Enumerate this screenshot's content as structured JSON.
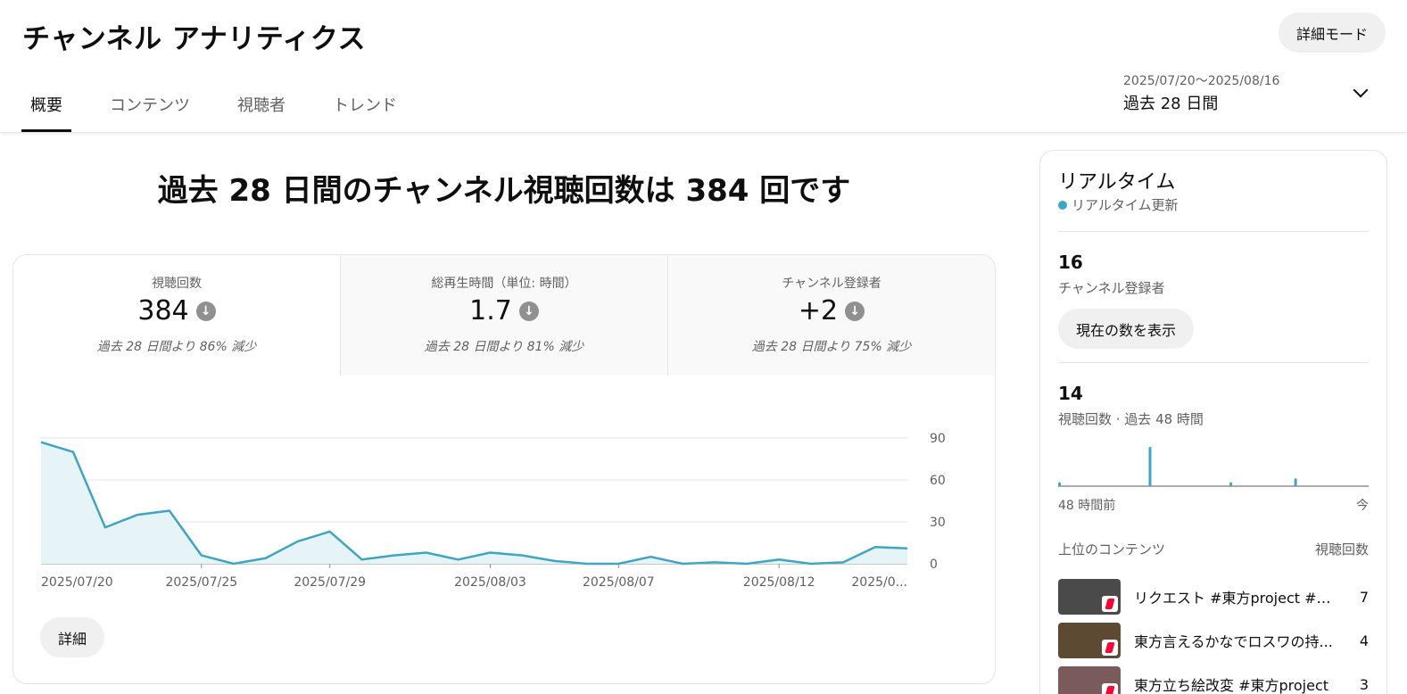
{
  "header": {
    "title": "チャンネル アナリティクス",
    "advanced_mode": "詳細モード"
  },
  "tabs": [
    {
      "label": "概要",
      "active": true
    },
    {
      "label": "コンテンツ",
      "active": false
    },
    {
      "label": "視聴者",
      "active": false
    },
    {
      "label": "トレンド",
      "active": false
    }
  ],
  "date_picker": {
    "range": "2025/07/20〜2025/08/16",
    "label": "過去 28 日間"
  },
  "headline": "過去 28 日間のチャンネル視聴回数は 384 回です",
  "metrics": [
    {
      "label": "視聴回数",
      "value": "384",
      "change": "過去 28 日間より 86% 減少",
      "trend": "down"
    },
    {
      "label": "総再生時間（単位: 時間）",
      "value": "1.7",
      "change": "過去 28 日間より 81% 減少",
      "trend": "down"
    },
    {
      "label": "チャンネル登録者",
      "value": "+2",
      "change": "過去 28 日間より 75% 減少",
      "trend": "down"
    }
  ],
  "details_button": "詳細",
  "chart_data": {
    "type": "area",
    "x": [
      "2025/07/20",
      "2025/07/21",
      "2025/07/22",
      "2025/07/23",
      "2025/07/24",
      "2025/07/25",
      "2025/07/26",
      "2025/07/27",
      "2025/07/28",
      "2025/07/29",
      "2025/07/30",
      "2025/07/31",
      "2025/08/01",
      "2025/08/02",
      "2025/08/03",
      "2025/08/04",
      "2025/08/05",
      "2025/08/06",
      "2025/08/07",
      "2025/08/08",
      "2025/08/09",
      "2025/08/10",
      "2025/08/11",
      "2025/08/12",
      "2025/08/13",
      "2025/08/14",
      "2025/08/15",
      "2025/08/16"
    ],
    "values": [
      87,
      80,
      26,
      35,
      38,
      6,
      0,
      4,
      16,
      23,
      3,
      6,
      8,
      3,
      8,
      6,
      2,
      0,
      0,
      5,
      0,
      1,
      0,
      3,
      0,
      1,
      12,
      11
    ],
    "tick_labels": [
      "2025/07/20",
      "2025/07/25",
      "2025/07/29",
      "2025/08/03",
      "2025/08/07",
      "2025/08/12",
      "2025/0..."
    ],
    "tick_indices": [
      0,
      5,
      9,
      14,
      18,
      23,
      27
    ],
    "y_ticks": [
      0,
      30,
      60,
      90
    ],
    "ylim": [
      0,
      90
    ],
    "grid": true,
    "line_color": "#3ea6c5",
    "fill_color": "#e6f4f8"
  },
  "realtime": {
    "title": "リアルタイム",
    "live_label": "リアルタイム更新",
    "subscribers_count": "16",
    "subscribers_label": "チャンネル登録者",
    "show_current_button": "現在の数を表示",
    "views_count": "14",
    "views_label": "視聴回数 · 過去 48 時間",
    "axis_left": "48 時間前",
    "axis_right": "今",
    "bars": [
      1,
      0,
      0,
      0,
      0,
      0,
      0,
      0,
      0,
      0,
      0,
      0,
      0,
      0,
      0,
      0,
      0,
      0,
      0,
      0,
      0,
      0,
      0,
      0,
      0,
      0,
      0,
      0,
      10,
      0,
      0,
      0,
      0,
      0,
      0,
      0,
      0,
      0,
      0,
      0,
      0,
      0,
      0,
      0,
      0,
      0,
      0,
      0,
      0,
      0,
      0,
      0,
      0,
      1,
      0,
      0,
      0,
      0,
      0,
      0,
      0,
      0,
      0,
      0,
      0,
      0,
      0,
      0,
      0,
      0,
      0,
      0,
      0,
      2,
      0,
      0,
      0,
      0,
      0,
      0,
      0,
      0,
      0,
      0,
      0,
      0,
      0,
      0,
      0,
      0,
      0,
      0,
      0,
      0,
      0,
      0
    ],
    "top_content_header": "上位のコンテンツ",
    "top_content_views_header": "視聴回数",
    "top_content": [
      {
        "title": "リクエスト #東方project #て...",
        "views": "7",
        "thumb_color": "#4a4a4a"
      },
      {
        "title": "東方言えるかなでロスワの持...",
        "views": "4",
        "thumb_color": "#5c4a32"
      },
      {
        "title": "東方立ち絵改変 #東方project",
        "views": "3",
        "thumb_color": "#7a5a5a"
      }
    ],
    "accent_color": "#3ea6c5"
  }
}
